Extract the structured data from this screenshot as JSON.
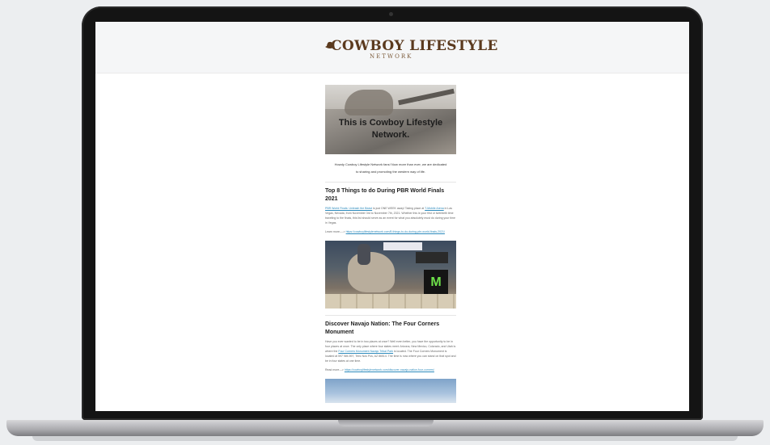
{
  "brand": {
    "name_main": "COWBOY LIFESTYLE",
    "name_sub": "NETWORK"
  },
  "hero": {
    "headline": "This is Cowboy Lifestyle Network."
  },
  "intro": {
    "line1": "Howdy Cowboy Lifestyle Network fans! Now more than ever, we are dedicated",
    "line2": "to sharing and promoting the western way of life."
  },
  "articles": [
    {
      "title": "Top 8 Things to do During PBR World Finals 2021",
      "link1": "PBR World Finals: Unleash the Beast",
      "text1": " is just ONE WEEK away! Taking place at ",
      "link2": "T-Mobile Arena",
      "text2": " in Las Vegas, Nevada, from November 3rd to November 7th, 2021. Whether this is your first or twentieth time traveling to the finals, this list should serve as an event for what you absolutely must do during your time in Vegas.",
      "learn_label": "Learn more----> ",
      "learn_url": "https://cowboylifestylenetwork.com/8-things-to-do-during-pbr-world-finals-2021/"
    },
    {
      "title": "Discover Navajo Nation: The Four Corners Monument",
      "text1": "Have you ever wanted to be in two places at once? Well even better, you have the opportunity to be in four places at once. The only place where four states meet: Arizona, New Mexico, Colorado, and Utah is where the ",
      "link1": "Four Corners Monument Navajo Tribal Park",
      "text2": " is located. The Four Corners Monument is located at 597 NM-597, Teec Nos Pos, AZ 86514. The time is now where you can stand on that spot and be in four states at one time.",
      "learn_label": "Read more---> ",
      "learn_url": "https://cowboylifestylenetwork.com/discover-navajo-nation-four-corners/"
    }
  ],
  "icons": {
    "brand_logo": "cowboy-hat-icon",
    "sponsor_mark": "claw-icon"
  },
  "colors": {
    "brand_brown": "#5b3a1e",
    "link_blue": "#2d8bbd",
    "laptop_frame": "#141414"
  }
}
